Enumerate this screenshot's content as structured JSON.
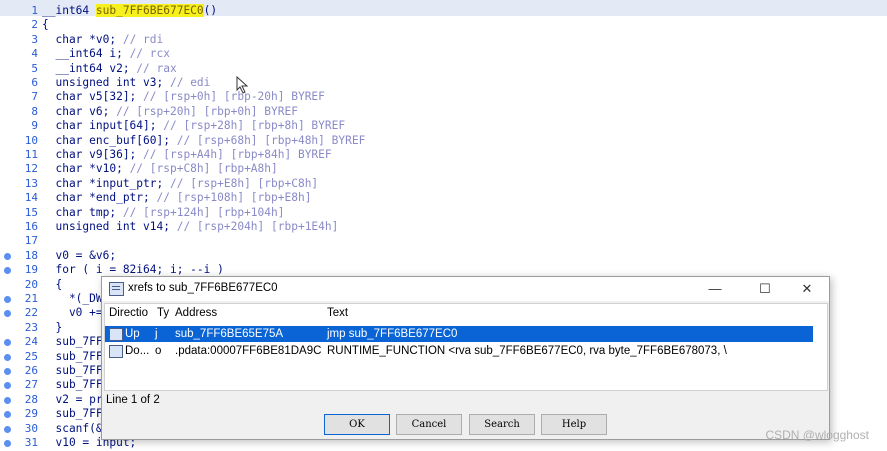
{
  "editor": {
    "lines": [
      {
        "n": "1",
        "text": "__int64 ",
        "ident": "sub_7FF6BE677EC0",
        "after": "()",
        "hl": true
      },
      {
        "n": "2",
        "text": "{"
      },
      {
        "n": "3",
        "text": "  char *v0; ",
        "comment": "// rdi"
      },
      {
        "n": "4",
        "text": "  __int64 i; ",
        "comment": "// rcx"
      },
      {
        "n": "5",
        "text": "  __int64 v2; ",
        "comment": "// rax"
      },
      {
        "n": "6",
        "text": "  unsigned int v3; ",
        "comment": "// edi"
      },
      {
        "n": "7",
        "text": "  char v5[32]; ",
        "comment": "// [rsp+0h] [rbp-20h] BYREF"
      },
      {
        "n": "8",
        "text": "  char v6; ",
        "comment": "// [rsp+20h] [rbp+0h] BYREF"
      },
      {
        "n": "9",
        "text": "  char input[64]; ",
        "comment": "// [rsp+28h] [rbp+8h] BYREF"
      },
      {
        "n": "10",
        "text": "  char enc_buf[60]; ",
        "comment": "// [rsp+68h] [rbp+48h] BYREF"
      },
      {
        "n": "11",
        "text": "  char v9[36]; ",
        "comment": "// [rsp+A4h] [rbp+84h] BYREF"
      },
      {
        "n": "12",
        "text": "  char *v10; ",
        "comment": "// [rsp+C8h] [rbp+A8h]"
      },
      {
        "n": "13",
        "text": "  char *input_ptr; ",
        "comment": "// [rsp+E8h] [rbp+C8h]"
      },
      {
        "n": "14",
        "text": "  char *end_ptr; ",
        "comment": "// [rsp+108h] [rbp+E8h]"
      },
      {
        "n": "15",
        "text": "  char tmp; ",
        "comment": "// [rsp+124h] [rbp+104h]"
      },
      {
        "n": "16",
        "text": "  unsigned int v14; ",
        "comment": "// [rsp+204h] [rbp+1E4h]"
      },
      {
        "n": "17",
        "text": ""
      },
      {
        "n": "18",
        "text": "  v0 = &v6;",
        "dot": true
      },
      {
        "n": "19",
        "text": "  for ( i = 82i64; i; --i )",
        "dot": true
      },
      {
        "n": "20",
        "text": "  {"
      },
      {
        "n": "21",
        "text": "    *(_DW",
        "dot": true
      },
      {
        "n": "22",
        "text": "    v0 +=",
        "dot": true
      },
      {
        "n": "23",
        "text": "  }"
      },
      {
        "n": "24",
        "text": "  sub_7FF",
        "dot": true
      },
      {
        "n": "25",
        "text": "  sub_7FF",
        "dot": true
      },
      {
        "n": "26",
        "text": "  sub_7FF",
        "dot": true
      },
      {
        "n": "27",
        "text": "  sub_7FF",
        "dot": true
      },
      {
        "n": "28",
        "text": "  v2 = pr",
        "dot": true
      },
      {
        "n": "29",
        "text": "  sub_7FF",
        "dot": true
      },
      {
        "n": "30",
        "text": "  scanf(&",
        "dot": true
      },
      {
        "n": "31",
        "text": "  v10 = input;",
        "dot": true
      }
    ]
  },
  "dialog": {
    "title": "xrefs to sub_7FF6BE677EC0",
    "controls": {
      "minimize": "—",
      "maximize": "☐",
      "close": "✕"
    },
    "columns": [
      "Directio",
      "Ty",
      "Address",
      "Text"
    ],
    "rows": [
      {
        "direction": "Up",
        "type": "j",
        "address": "sub_7FF6BE65E75A",
        "text": "jmp    sub_7FF6BE677EC0",
        "selected": true
      },
      {
        "direction": "Do...",
        "type": "o",
        "address": ".pdata:00007FF6BE81DA9C",
        "text": "RUNTIME_FUNCTION <rva sub_7FF6BE677EC0, rva byte_7FF6BE678073, \\",
        "selected": false
      }
    ],
    "status": "Line 1 of 2",
    "buttons": {
      "ok": "OK",
      "cancel": "Cancel",
      "search": "Search",
      "help": "Help"
    }
  },
  "watermark": "CSDN @wlogghost"
}
